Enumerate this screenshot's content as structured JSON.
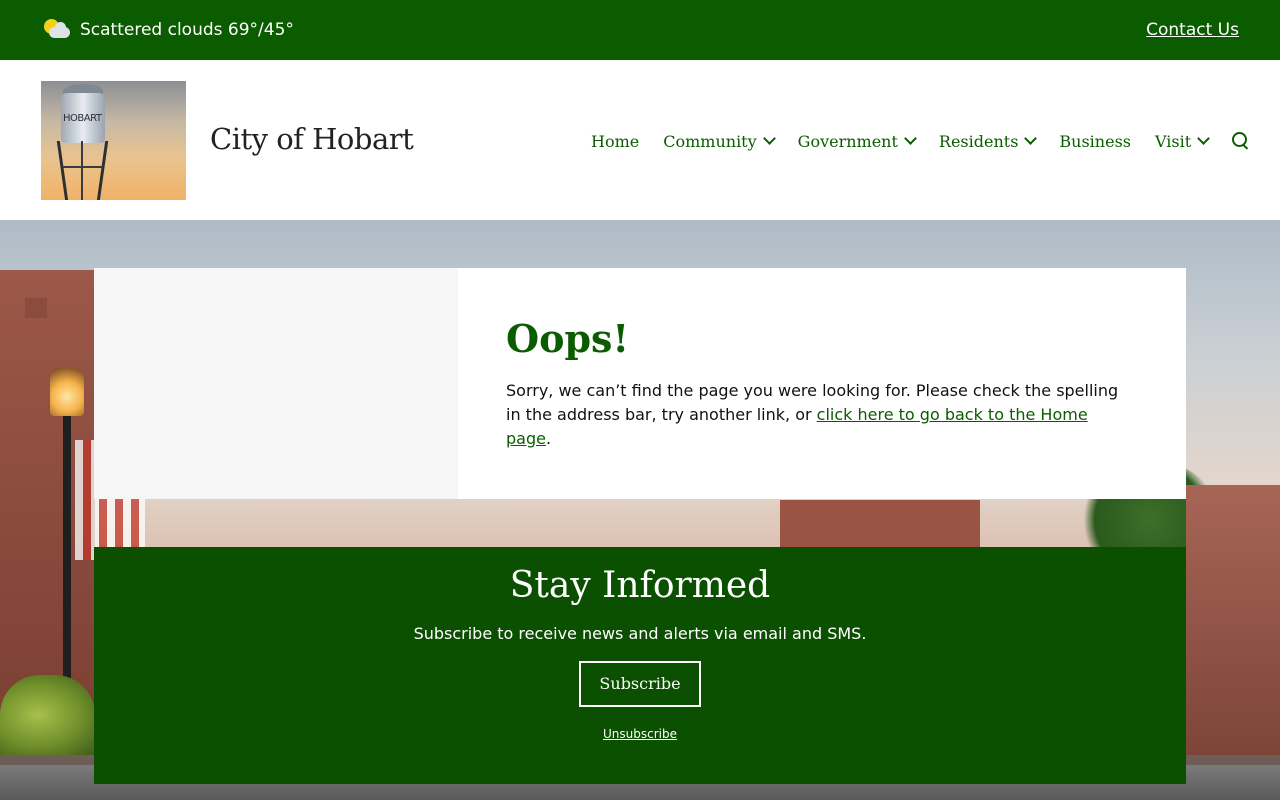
{
  "topbar": {
    "weather_text": "Scattered clouds 69°/45°",
    "weather_icon": "partly-cloudy-icon",
    "contact_label": "Contact Us"
  },
  "header": {
    "site_title": "City of Hobart",
    "logo_text": "HOBART",
    "nav": [
      {
        "label": "Home",
        "has_dropdown": false
      },
      {
        "label": "Community",
        "has_dropdown": true
      },
      {
        "label": "Government",
        "has_dropdown": true
      },
      {
        "label": "Residents",
        "has_dropdown": true
      },
      {
        "label": "Business",
        "has_dropdown": false
      },
      {
        "label": "Visit",
        "has_dropdown": true
      }
    ],
    "search_icon": "search-icon"
  },
  "error": {
    "title": "Oops!",
    "message": "Sorry, we can’t find the page you were looking for. Please check the spelling in the address bar, try another link, or ",
    "link_label": "click here to go back to the Home page",
    "message_end": "."
  },
  "informed": {
    "title": "Stay Informed",
    "subtitle": "Subscribe to receive news and alerts via email and SMS.",
    "subscribe_label": "Subscribe",
    "unsubscribe_label": "Unsubscribe"
  },
  "colors": {
    "brand_green": "#0b5c00",
    "section_green": "#0b5000",
    "card_left_gray": "#f6f6f6"
  }
}
